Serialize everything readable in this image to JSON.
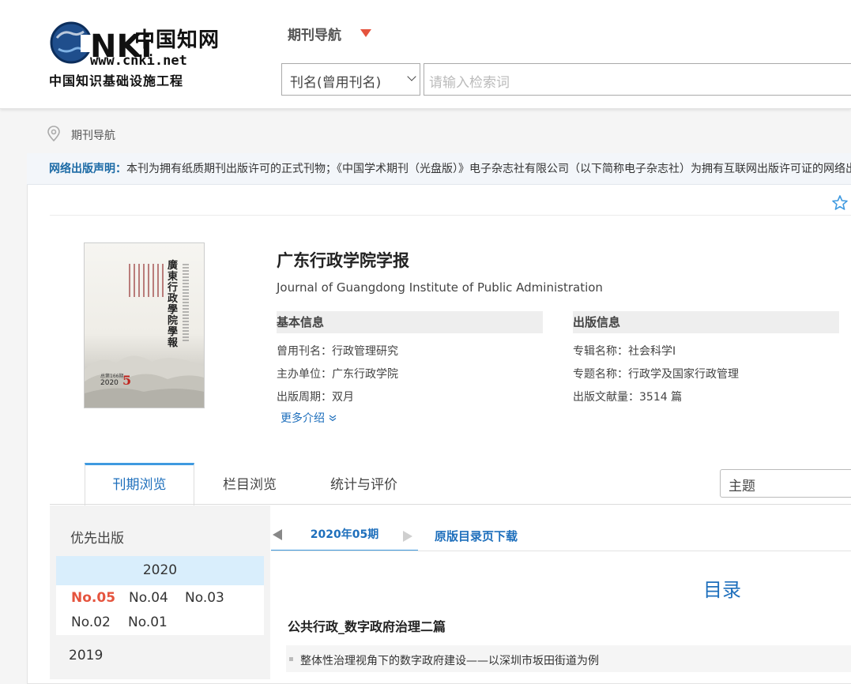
{
  "header": {
    "logo": {
      "brand_text": "中国知网",
      "url_text": "www.cnki.net",
      "tagline": "中国知识基础设施工程"
    },
    "nav_label": "期刊导航",
    "search": {
      "field_selected": "刊名(曾用刊名)",
      "placeholder": "请输入检索词"
    }
  },
  "breadcrumb": "期刊导航",
  "notice": {
    "label": "网络出版声明：",
    "text": "本刊为拥有纸质期刊出版许可的正式刊物；《中国学术期刊（光盘版）》电子杂志社有限公司（以下简称电子杂志社）为拥有互联网出版许可证的网络出版单位"
  },
  "journal": {
    "title": "广东行政学院学报",
    "english_title": "Journal of Guangdong Institute of Public Administration",
    "cover": {
      "title": "廣東行政學院學報",
      "issue_line": "总第166期",
      "year": "2020",
      "number": "5"
    },
    "basic": {
      "heading": "基本信息",
      "rows": [
        {
          "label": "曾用刊名：",
          "value": "行政管理研究"
        },
        {
          "label": "主办单位：",
          "value": "广东行政学院"
        },
        {
          "label": "出版周期：",
          "value": "双月"
        }
      ]
    },
    "publication": {
      "heading": "出版信息",
      "rows": [
        {
          "label": "专辑名称：",
          "value": "社会科学Ⅰ"
        },
        {
          "label": "专题名称：",
          "value": "行政学及国家行政管理"
        },
        {
          "label": "出版文献量：",
          "value": "3514 篇"
        }
      ]
    },
    "more_link": "更多介绍"
  },
  "tabs": {
    "items": [
      "刊期浏览",
      "栏目浏览",
      "统计与评价"
    ],
    "active": "刊期浏览"
  },
  "topic_select": "主题",
  "left_panel": {
    "priority": "优先出版",
    "years": [
      {
        "year": "2020",
        "issues": [
          "No.05",
          "No.04",
          "No.03",
          "No.02",
          "No.01"
        ],
        "selected": "No.05"
      },
      {
        "year": "2019"
      }
    ]
  },
  "issue_nav": {
    "current": "2020年05期",
    "download": "原版目录页下载"
  },
  "toc": {
    "title": "目录",
    "sections": [
      {
        "name": "公共行政_数字政府治理二篇",
        "articles": [
          "整体性治理视角下的数字政府建设——以深圳市坂田街道为例"
        ]
      }
    ]
  },
  "colors": {
    "accent": "#1e6fbc",
    "selected_issue": "#e5543e",
    "year_highlight": "#d9eefc",
    "tab_border": "#3f9ae0"
  }
}
